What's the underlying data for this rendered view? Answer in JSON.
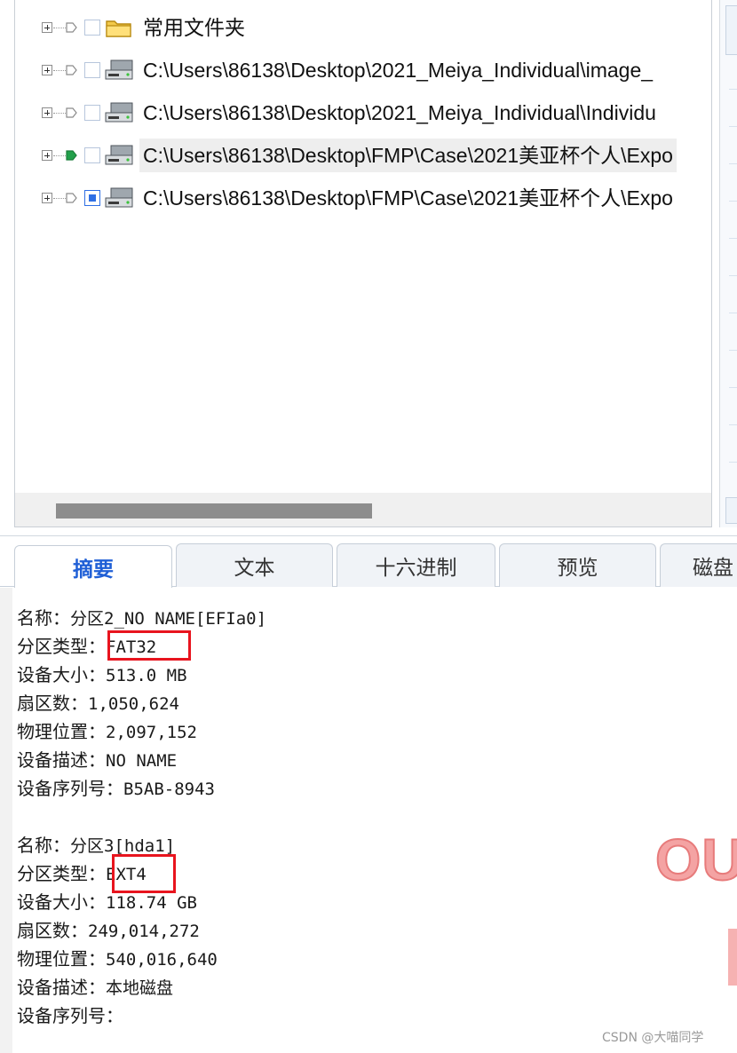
{
  "tree": {
    "rows": [
      {
        "label": "常用文件夹",
        "icon": "folder-icon",
        "flag": "hollow",
        "checkbox": "unchecked",
        "selected": false
      },
      {
        "label": "C:\\Users\\86138\\Desktop\\2021_Meiya_Individual\\image_",
        "icon": "disk-drive-icon",
        "flag": "hollow",
        "checkbox": "unchecked",
        "selected": false
      },
      {
        "label": "C:\\Users\\86138\\Desktop\\2021_Meiya_Individual\\Individu",
        "icon": "disk-drive-icon",
        "flag": "hollow",
        "checkbox": "unchecked",
        "selected": false
      },
      {
        "label": "C:\\Users\\86138\\Desktop\\FMP\\Case\\2021美亚杯个人\\Expo",
        "icon": "disk-drive-icon",
        "flag": "green",
        "checkbox": "unchecked",
        "selected": true
      },
      {
        "label": "C:\\Users\\86138\\Desktop\\FMP\\Case\\2021美亚杯个人\\Expo",
        "icon": "disk-drive-icon",
        "flag": "hollow",
        "checkbox": "partial",
        "selected": false
      }
    ]
  },
  "tabs": [
    {
      "label": "摘要",
      "active": true
    },
    {
      "label": "文本",
      "active": false
    },
    {
      "label": "十六进制",
      "active": false
    },
    {
      "label": "预览",
      "active": false
    },
    {
      "label": "磁盘",
      "active": false
    }
  ],
  "partitions": [
    {
      "lines": [
        {
          "key": "名称：",
          "value": "分区2_NO NAME[EFIa0]"
        },
        {
          "key": "分区类型：",
          "value": "FAT32"
        },
        {
          "key": "设备大小：",
          "value": "513.0 MB"
        },
        {
          "key": "扇区数：",
          "value": "1,050,624"
        },
        {
          "key": "物理位置：",
          "value": "2,097,152"
        },
        {
          "key": "设备描述：",
          "value": "NO NAME"
        },
        {
          "key": "设备序列号：",
          "value": "B5AB-8943"
        }
      ]
    },
    {
      "lines": [
        {
          "key": "名称：",
          "value": "分区3[hda1]"
        },
        {
          "key": "分区类型：",
          "value": "EXT4"
        },
        {
          "key": "设备大小：",
          "value": "118.74 GB"
        },
        {
          "key": "扇区数：",
          "value": "249,014,272"
        },
        {
          "key": "物理位置：",
          "value": "540,016,640"
        },
        {
          "key": "设备描述：",
          "value": "本地磁盘"
        },
        {
          "key": "设备序列号：",
          "value": ""
        }
      ]
    }
  ],
  "overlay_text": "OU",
  "watermark": "CSDN @大喵同学",
  "colors": {
    "highlight_box": "#e8141e",
    "active_tab": "#1f5fd6",
    "green_flag": "#22a04b",
    "partial_check": "#2f6fe4"
  }
}
